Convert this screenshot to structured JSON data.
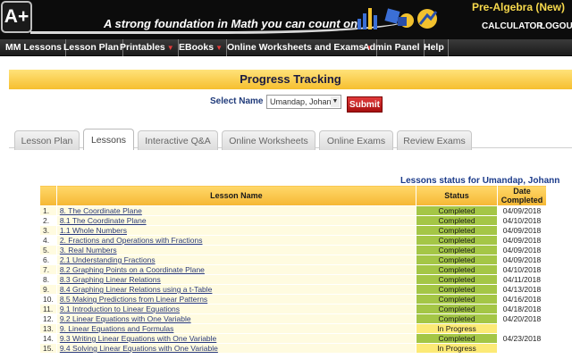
{
  "header": {
    "logo": "A+",
    "tagline": "A strong foundation in Math you can count on!",
    "course": "Pre-Algebra (New)",
    "calculator": "CALCULATOR",
    "logout": "LOGOUT"
  },
  "nav": [
    {
      "label": "MM Lessons",
      "caret": false
    },
    {
      "label": "Lesson Plan",
      "caret": false
    },
    {
      "label": "Printables",
      "caret": true
    },
    {
      "label": "EBooks",
      "caret": true
    },
    {
      "label": "Online Worksheets and Exams",
      "caret": true
    },
    {
      "label": "Admin Panel",
      "caret": false
    },
    {
      "label": "Help",
      "caret": false
    }
  ],
  "page": {
    "title": "Progress Tracking",
    "select_label": "Select Name :",
    "selected_name": "Umandap, Johann",
    "submit": "Submit"
  },
  "tabs": [
    "Lesson Plan",
    "Lessons",
    "Interactive Q&A",
    "Online Worksheets",
    "Online Exams",
    "Review Exams"
  ],
  "active_tab": "Lessons",
  "status_caption": "Lessons status for Umandap, Johann",
  "table": {
    "headers": {
      "name": "Lesson Name",
      "status": "Status",
      "date": "Date Completed"
    },
    "rows": [
      {
        "num": "1.",
        "name": "8. The Coordinate Plane",
        "status": "Completed",
        "date": "04/09/2018"
      },
      {
        "num": "2.",
        "name": "8.1 The Coordinate Plane",
        "status": "Completed",
        "date": "04/10/2018"
      },
      {
        "num": "3.",
        "name": "1.1 Whole Numbers",
        "status": "Completed",
        "date": "04/09/2018"
      },
      {
        "num": "4.",
        "name": "2. Fractions and Operations with Fractions",
        "status": "Completed",
        "date": "04/09/2018"
      },
      {
        "num": "5.",
        "name": "3. Real Numbers",
        "status": "Completed",
        "date": "04/09/2018"
      },
      {
        "num": "6.",
        "name": "2.1 Understanding Fractions",
        "status": "Completed",
        "date": "04/09/2018"
      },
      {
        "num": "7.",
        "name": "8.2 Graphing Points on a Coordinate Plane",
        "status": "Completed",
        "date": "04/10/2018"
      },
      {
        "num": "8.",
        "name": "8.3 Graphing Linear Relations",
        "status": "Completed",
        "date": "04/11/2018"
      },
      {
        "num": "9.",
        "name": "8.4 Graphing Linear Relations using a t-Table",
        "status": "Completed",
        "date": "04/13/2018"
      },
      {
        "num": "10.",
        "name": "8.5 Making Predictions from Linear Patterns",
        "status": "Completed",
        "date": "04/16/2018"
      },
      {
        "num": "11.",
        "name": "9.1 Introduction to Linear Equations",
        "status": "Completed",
        "date": "04/18/2018"
      },
      {
        "num": "12.",
        "name": "9.2 Linear Equations with One Variable",
        "status": "Completed",
        "date": "04/20/2018"
      },
      {
        "num": "13.",
        "name": "9. Linear Equations and Formulas",
        "status": "In Progress",
        "date": ""
      },
      {
        "num": "14.",
        "name": "9.3 Writing Linear Equations with One Variable",
        "status": "Completed",
        "date": "04/23/2018"
      },
      {
        "num": "15.",
        "name": "9.4 Solving Linear Equations with One Variable",
        "status": "In Progress",
        "date": ""
      }
    ]
  },
  "colors": {
    "completed": "#a4c646",
    "in_progress": "#fcea76",
    "header_gold": "#f5b734",
    "submit_red": "#c21f1f"
  }
}
